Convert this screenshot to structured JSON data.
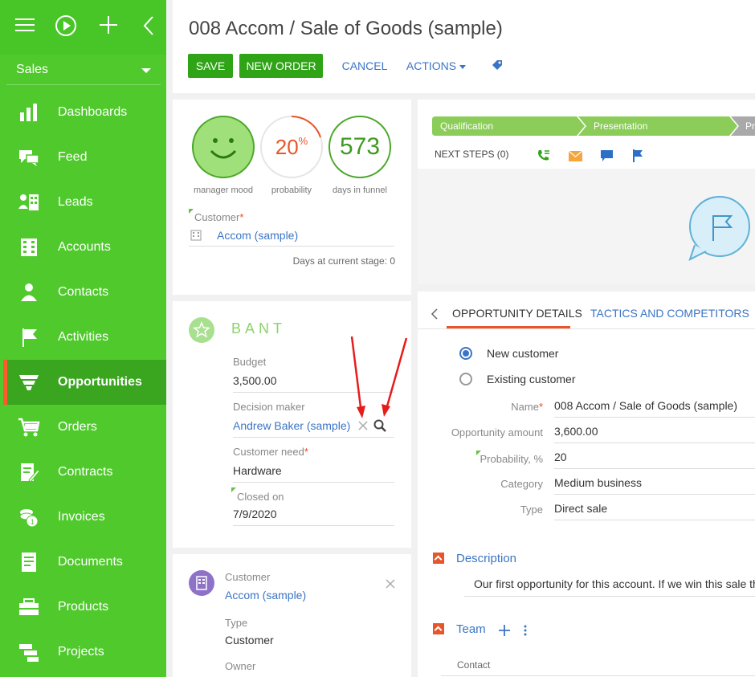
{
  "sidebar": {
    "workplace": "Sales",
    "items": [
      {
        "label": "Dashboards",
        "icon": "dashboards-icon"
      },
      {
        "label": "Feed",
        "icon": "feed-icon"
      },
      {
        "label": "Leads",
        "icon": "leads-icon"
      },
      {
        "label": "Accounts",
        "icon": "accounts-icon"
      },
      {
        "label": "Contacts",
        "icon": "contacts-icon"
      },
      {
        "label": "Activities",
        "icon": "activities-icon"
      },
      {
        "label": "Opportunities",
        "icon": "opportunities-icon",
        "active": true
      },
      {
        "label": "Orders",
        "icon": "orders-icon"
      },
      {
        "label": "Contracts",
        "icon": "contracts-icon"
      },
      {
        "label": "Invoices",
        "icon": "invoices-icon"
      },
      {
        "label": "Documents",
        "icon": "documents-icon"
      },
      {
        "label": "Products",
        "icon": "products-icon"
      },
      {
        "label": "Projects",
        "icon": "projects-icon"
      }
    ]
  },
  "header": {
    "title": "008 Accom / Sale of Goods (sample)",
    "save": "SAVE",
    "new_order": "NEW ORDER",
    "cancel": "CANCEL",
    "actions": "ACTIONS"
  },
  "summary": {
    "mood_label": "manager mood",
    "probability_value": "20",
    "probability_unit": "%",
    "probability_label": "probability",
    "days_value": "573",
    "days_label": "days in funnel",
    "customer_label": "Customer",
    "customer_value": "Accom (sample)",
    "days_stage_label": "Days at current stage:",
    "days_stage_value": "0"
  },
  "bant": {
    "title": "BANT",
    "budget_label": "Budget",
    "budget_value": "3,500.00",
    "decision_label": "Decision maker",
    "decision_value": "Andrew Baker (sample)",
    "need_label": "Customer need",
    "need_value": "Hardware",
    "closed_label": "Closed on",
    "closed_value": "7/9/2020"
  },
  "customer_card": {
    "customer_label": "Customer",
    "customer_value": "Accom (sample)",
    "type_label": "Type",
    "type_value": "Customer",
    "owner_label": "Owner"
  },
  "stages": [
    "Qualification",
    "Presentation",
    "Pr"
  ],
  "next_steps": "NEXT STEPS (0)",
  "tabs": [
    "OPPORTUNITY DETAILS",
    "TACTICS AND COMPETITORS"
  ],
  "details": {
    "radio_new": "New customer",
    "radio_existing": "Existing customer",
    "name_label": "Name",
    "name_value": "008 Accom / Sale of Goods (sample)",
    "amount_label": "Opportunity amount",
    "amount_value": "3,600.00",
    "prob_label": "Probability, %",
    "prob_value": "20",
    "category_label": "Category",
    "category_value": "Medium business",
    "type_label": "Type",
    "type_value": "Direct sale",
    "description_title": "Description",
    "description_text": "Our first opportunity for this account. If we win this sale th",
    "team_title": "Team",
    "contact_col": "Contact"
  },
  "colors": {
    "sidebar": "#4fc92c",
    "accent_green": "#2fa416",
    "link": "#3b74c5",
    "alert": "#e8552b"
  }
}
